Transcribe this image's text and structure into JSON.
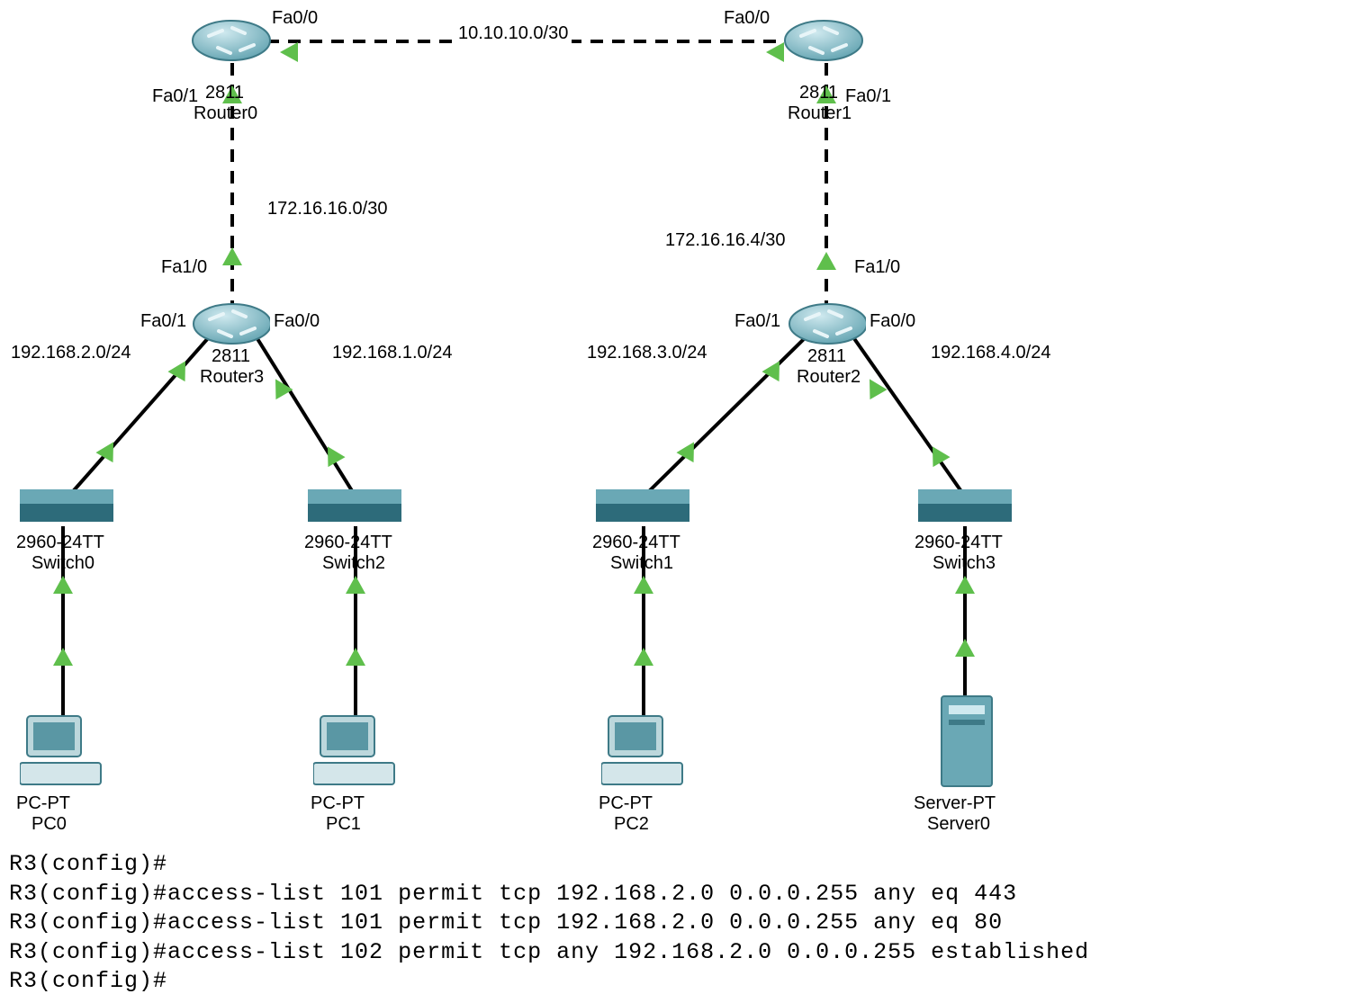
{
  "networks": {
    "top_link": "10.10.10.0/30",
    "left_mid": "172.16.16.0/30",
    "right_mid": "172.16.16.4/30",
    "lan_left_outer": "192.168.2.0/24",
    "lan_left_inner": "192.168.1.0/24",
    "lan_right_outer": "192.168.3.0/24",
    "lan_right_inner": "192.168.4.0/24"
  },
  "interfaces": {
    "r0_fa00": "Fa0/0",
    "r0_fa01": "Fa0/1",
    "r1_fa00": "Fa0/0",
    "r1_fa01": "Fa0/1",
    "r3_fa10": "Fa1/0",
    "r3_fa01": "Fa0/1",
    "r3_fa00": "Fa0/0",
    "r2_fa10": "Fa1/0",
    "r2_fa01": "Fa0/1",
    "r2_fa00": "Fa0/0"
  },
  "devices": {
    "router0_model": "2811",
    "router0_name": "Router0",
    "router1_model": "2811",
    "router1_name": "Router1",
    "router3_model": "2811",
    "router3_name": "Router3",
    "router2_model": "2811",
    "router2_name": "Router2",
    "sw0_model": "2960-24TT",
    "sw0_name": "Switch0",
    "sw2_model": "2960-24TT",
    "sw2_name": "Switch2",
    "sw1_model": "2960-24TT",
    "sw1_name": "Switch1",
    "sw3_model": "2960-24TT",
    "sw3_name": "Switch3",
    "pc0_model": "PC-PT",
    "pc0_name": "PC0",
    "pc1_model": "PC-PT",
    "pc1_name": "PC1",
    "pc2_model": "PC-PT",
    "pc2_name": "PC2",
    "srv0_model": "Server-PT",
    "srv0_name": "Server0"
  },
  "cli": {
    "l1": "R3(config)#",
    "l2": "R3(config)#access-list 101 permit tcp 192.168.2.0 0.0.0.255 any eq 443",
    "l3": "R3(config)#access-list 101 permit tcp 192.168.2.0 0.0.0.255 any eq 80",
    "l4": "R3(config)#access-list 102 permit tcp any 192.168.2.0 0.0.0.255 established",
    "l5": "R3(config)#"
  }
}
